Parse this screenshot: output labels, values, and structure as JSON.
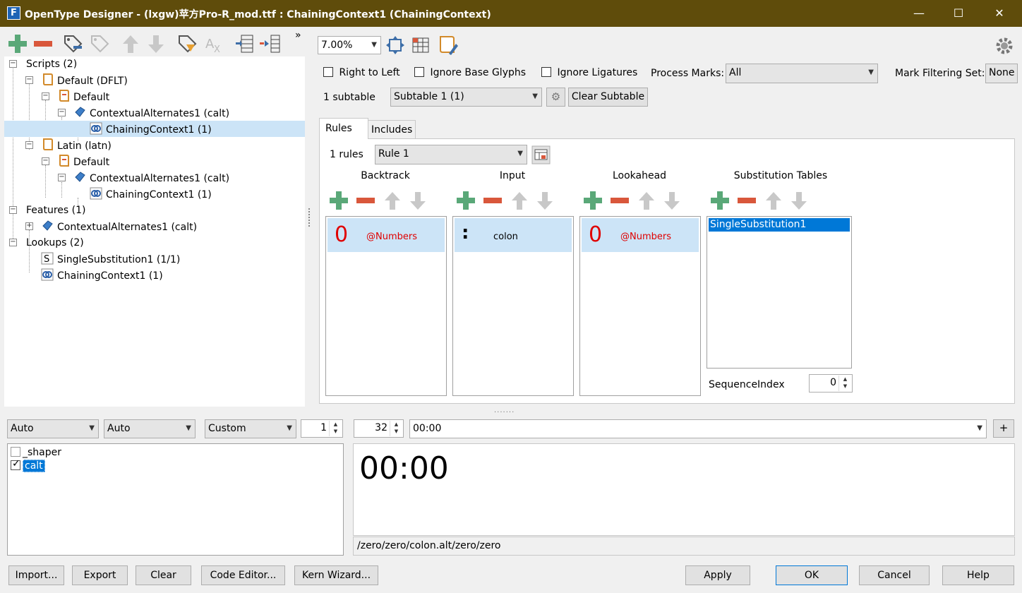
{
  "window": {
    "app_icon": "F",
    "title": "OpenType Designer - (lxgw)苹方Pro-R_mod.ttf : ChainingContext1 (ChainingContext)",
    "minimize": "—",
    "maximize": "☐",
    "close": "✕"
  },
  "toolbar": {
    "more": "»"
  },
  "tree": {
    "scripts": "Scripts (2)",
    "default_dflt": "Default (DFLT)",
    "default_1": "Default",
    "calt_1": "ContextualAlternates1 (calt)",
    "chaining_1": "ChainingContext1 (1)",
    "latin": "Latin (latn)",
    "default_2": "Default",
    "calt_2": "ContextualAlternates1 (calt)",
    "chaining_2": "ChainingContext1 (1)",
    "features": "Features (1)",
    "calt_3": "ContextualAlternates1 (calt)",
    "lookups": "Lookups (2)",
    "single": "SingleSubstitution1 (1/1)",
    "chaining_3": "ChainingContext1 (1)"
  },
  "zoom": {
    "value": "7.00%"
  },
  "options": {
    "right_to_left": "Right to Left",
    "ignore_base": "Ignore Base Glyphs",
    "ignore_lig": "Ignore Ligatures",
    "process_marks_label": "Process Marks:",
    "process_marks_value": "All",
    "mark_filter_label": "Mark Filtering Set:",
    "mark_filter_value": "None",
    "subtable_count": "1 subtable",
    "subtable_value": "Subtable 1 (1)",
    "clear_subtable": "Clear Subtable"
  },
  "tabs": {
    "rules": "Rules",
    "includes": "Includes"
  },
  "rules": {
    "count": "1 rules",
    "selected": "Rule 1",
    "backtrack": "Backtrack",
    "input": "Input",
    "lookahead": "Lookahead",
    "subst_tables": "Substitution Tables",
    "backtrack_glyph": "0",
    "backtrack_name": "@Numbers",
    "input_glyph": ":",
    "input_name": "colon",
    "lookahead_glyph": "0",
    "lookahead_name": "@Numbers",
    "subst_item": "SingleSubstitution1",
    "sequence_label": "SequenceIndex",
    "sequence_value": "0"
  },
  "preview": {
    "combo1": "Auto",
    "combo2": "Auto",
    "combo3": "Custom",
    "spin1": "1",
    "size": "32",
    "text": "00:00",
    "add": "+",
    "feature_shaper": "_shaper",
    "feature_calt": "calt",
    "render": "00:00",
    "glyph_path": "/zero/zero/colon.alt/zero/zero",
    "splitter": "......."
  },
  "buttons": {
    "import": "Import...",
    "export": "Export",
    "clear": "Clear",
    "code_editor": "Code Editor...",
    "kern_wizard": "Kern Wizard...",
    "apply": "Apply",
    "ok": "OK",
    "cancel": "Cancel",
    "help": "Help"
  },
  "colors": {
    "titlebar": "#5f4c0b",
    "selection": "#0078d7",
    "row_highlight": "#cce4f7",
    "green": "#5aa878",
    "red": "#d9573b",
    "glyph_red": "#e00000"
  },
  "icons": [
    "add-icon",
    "remove-icon",
    "tag-edit-icon",
    "arrow-up-icon",
    "arrow-down-icon",
    "gear-icon",
    "script-icon",
    "feature-icon",
    "chain-icon",
    "fit-icon",
    "grid-icon",
    "edit-icon"
  ]
}
